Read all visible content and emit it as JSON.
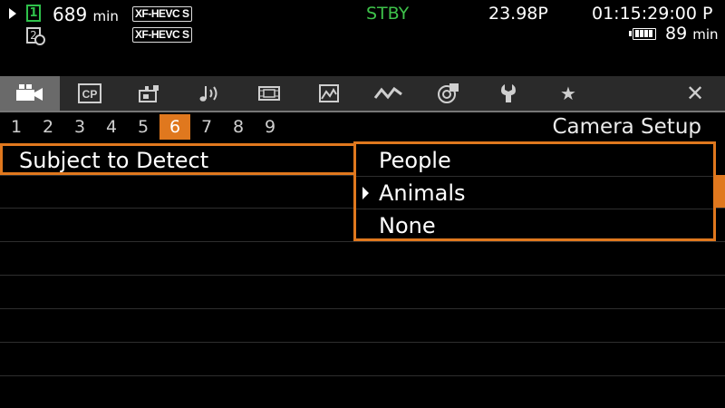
{
  "status": {
    "remaining_value": "689",
    "remaining_unit": "min",
    "slot1_label": "1",
    "slot2_label": "2",
    "format1": "XF-HEVC S",
    "format2": "XF-HEVC S",
    "rec_state": "STBY",
    "frame_rate": "23.98P",
    "timecode": "01:15:29:00 P",
    "battery_value": "89",
    "battery_unit": "min",
    "colors": {
      "stby": "#3ec24a",
      "slot1": "#2fc24b"
    }
  },
  "tabs": [
    {
      "icon": "movie-camera-icon",
      "active": true
    },
    {
      "icon": "cp-icon",
      "label": "CP"
    },
    {
      "icon": "camera-settings-icon"
    },
    {
      "icon": "audio-icon"
    },
    {
      "icon": "video-icon"
    },
    {
      "icon": "recording-media-icon"
    },
    {
      "icon": "assist-waveform-icon"
    },
    {
      "icon": "network-icon"
    },
    {
      "icon": "wrench-icon"
    },
    {
      "icon": "star-icon",
      "label": "★"
    },
    {
      "icon": "close-icon",
      "label": "✕"
    }
  ],
  "pages": {
    "numbers": [
      "1",
      "2",
      "3",
      "4",
      "5",
      "6",
      "7",
      "8",
      "9"
    ],
    "active": "6",
    "title": "Camera Setup"
  },
  "menu_item": {
    "label": "Subject to Detect"
  },
  "options": [
    {
      "label": "People",
      "selected": false
    },
    {
      "label": "Animals",
      "selected": true
    },
    {
      "label": "None",
      "selected": false
    }
  ],
  "accent_color": "#e0781e"
}
